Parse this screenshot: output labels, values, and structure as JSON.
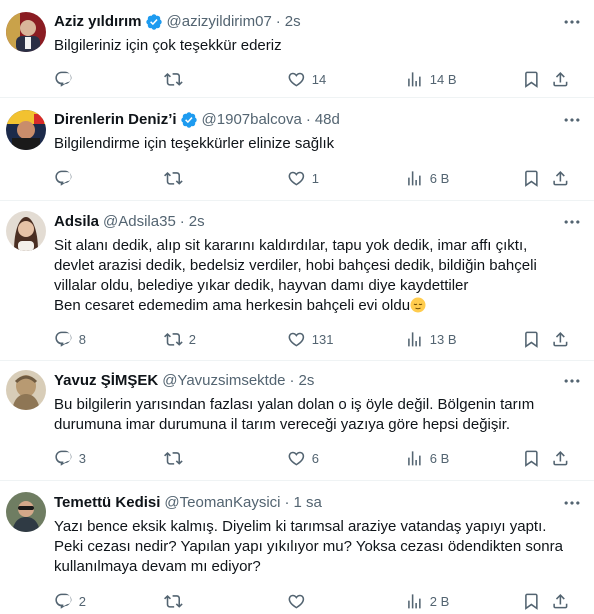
{
  "tweets": [
    {
      "name": "Aziz yıldırım",
      "verified": true,
      "handle": "@azizyildirim07",
      "time": "2s",
      "lines": [
        "Bilgileriniz için çok teşekkür ederiz"
      ],
      "reply_count": "",
      "retweet_count": "",
      "like_count": "14",
      "view_count": "14 B"
    },
    {
      "name": "Direnlerin Deniz’i",
      "verified": true,
      "handle": "@1907balcova",
      "time": "48d",
      "lines": [
        "Bilgilendirme için teşekkürler elinize sağlık"
      ],
      "reply_count": "",
      "retweet_count": "",
      "like_count": "1",
      "view_count": "6 B"
    },
    {
      "name": "Adsila",
      "verified": false,
      "handle": "@Adsila35",
      "time": "2s",
      "lines": [
        "Sit alanı dedik, alıp sit kararını kaldırdılar, tapu yok dedik,  imar affı çıktı,",
        "devlet arazisi dedik, bedelsiz verdiler, hobi bahçesi dedik, bildiğin bahçeli",
        "villalar oldu, belediye yıkar dedik, hayvan damı diye kaydettiler",
        "Ben cesaret edemedim ama  herkesin bahçeli evi oldu"
      ],
      "emoji": "relieved-face",
      "reply_count": "8",
      "retweet_count": "2",
      "like_count": "131",
      "view_count": "13 B"
    },
    {
      "name": "Yavuz ŞİMŞEK",
      "verified": false,
      "handle": "@Yavuzsimsektde",
      "time": "2s",
      "lines": [
        "Bu bilgilerin yarısından fazlası yalan dolan o iş öyle değil. Bölgenin tarım",
        "durumuna imar durumuna il tarım vereceği yazıya göre hepsi değişir."
      ],
      "reply_count": "3",
      "retweet_count": "",
      "like_count": "6",
      "view_count": "6 B"
    },
    {
      "name": "Temettü Kedisi",
      "verified": false,
      "handle": "@TeomanKaysici",
      "time": "1 sa",
      "lines": [
        "Yazı bence eksik kalmış. Diyelim ki tarımsal araziye vatandaş yapıyı yaptı.",
        "Peki cezası nedir? Yapılan yapı yıkılıyor mu? Yoksa cezası ödendikten sonra",
        "kullanılmaya devam mı ediyor?"
      ],
      "reply_count": "2",
      "retweet_count": "",
      "like_count": "",
      "view_count": "2 B"
    }
  ],
  "colors": {
    "text": "#0f1419",
    "secondary": "#536471",
    "verified": "#1d9bf0",
    "divider": "#eff3f4"
  },
  "icons": [
    "more-icon",
    "verified-badge-icon",
    "reply-icon",
    "retweet-icon",
    "like-icon",
    "views-icon",
    "bookmark-icon",
    "share-icon"
  ]
}
